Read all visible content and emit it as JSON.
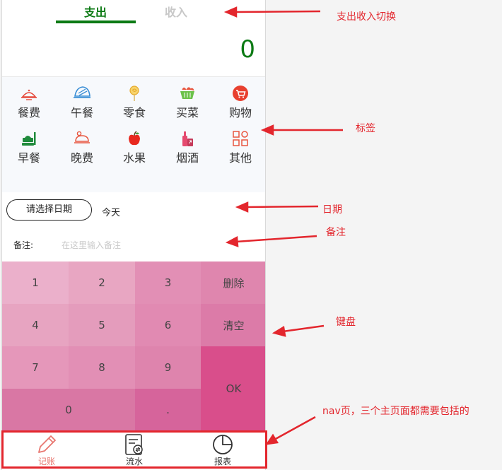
{
  "tabs": {
    "expense": "支出",
    "income": "收入"
  },
  "amount": "0",
  "categories": [
    {
      "label": "餐费",
      "icon": "dinner-plate-icon"
    },
    {
      "label": "午餐",
      "icon": "lunch-icon"
    },
    {
      "label": "零食",
      "icon": "snack-lollipop-icon"
    },
    {
      "label": "买菜",
      "icon": "vegetable-basket-icon"
    },
    {
      "label": "购物",
      "icon": "shopping-cart-icon"
    },
    {
      "label": "早餐",
      "icon": "breakfast-icon"
    },
    {
      "label": "晚费",
      "icon": "roast-chicken-icon"
    },
    {
      "label": "水果",
      "icon": "apple-icon"
    },
    {
      "label": "烟酒",
      "icon": "bottle-icon"
    },
    {
      "label": "其他",
      "icon": "grid-icon"
    }
  ],
  "date": {
    "button": "请选择日期",
    "value": "今天"
  },
  "note": {
    "label": "备注:",
    "placeholder": "在这里输入备注"
  },
  "keypad": {
    "k1": "1",
    "k2": "2",
    "k3": "3",
    "delete": "删除",
    "k4": "4",
    "k5": "5",
    "k6": "6",
    "clear": "清空",
    "k7": "7",
    "k8": "8",
    "k9": "9",
    "ok": "OK",
    "k0": "0",
    "dot": "."
  },
  "nav": {
    "record": "记账",
    "flow": "流水",
    "report": "报表"
  },
  "annotations": {
    "toggle": "支出收入切换",
    "tags": "标签",
    "date": "日期",
    "note": "备注",
    "keyboard": "键盘",
    "nav": "nav页，三个主页面都需要包括的"
  },
  "colors": {
    "accent": "#0c7a14",
    "annotation": "#e3262d",
    "ok": "#d94e8b"
  }
}
